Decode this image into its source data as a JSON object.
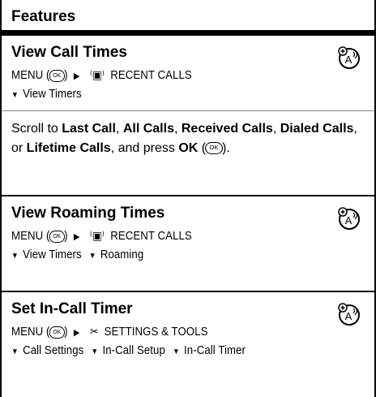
{
  "header": {
    "title": "Features"
  },
  "glyphs": {
    "ok": "OK",
    "triangle": "▶",
    "down": "▼",
    "phone": "⁽▣⁾",
    "tools": "✂"
  },
  "sections": [
    {
      "title": "View Call Times",
      "path1": {
        "menu": "MENU (",
        "menu_close": ")",
        "target": "RECENT CALLS"
      },
      "path2": [
        "View Timers"
      ],
      "description": {
        "prefix": "Scroll to ",
        "items": [
          "Last Call",
          "All Calls",
          "Received Calls",
          "Dialed Calls",
          "Lifetime Calls"
        ],
        "sep1": ", ",
        "sep2": ", ",
        "sep3": ", ",
        "sep4": ", or ",
        "suffix_a": ", and press ",
        "ok_label": "OK",
        "suffix_b": " (",
        "suffix_c": ")."
      }
    },
    {
      "title": "View Roaming Times",
      "path1": {
        "menu": "MENU (",
        "menu_close": ")",
        "target": "RECENT CALLS"
      },
      "path2": [
        "View Timers",
        "Roaming"
      ]
    },
    {
      "title": "Set In-Call Timer",
      "path1": {
        "menu": "MENU (",
        "menu_close": ")",
        "target": "SETTINGS & TOOLS"
      },
      "path2": [
        "Call Settings",
        "In-Call Setup",
        "In-Call Timer"
      ]
    }
  ]
}
